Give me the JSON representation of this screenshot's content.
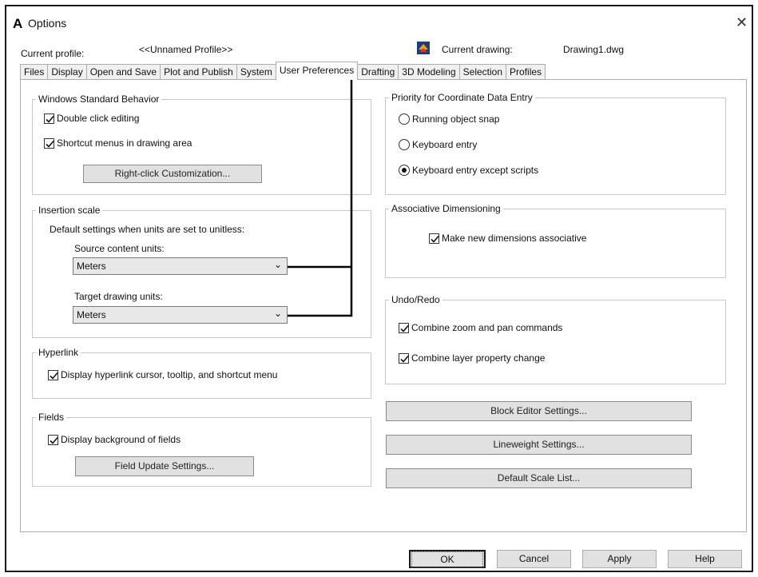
{
  "window": {
    "logo": "A",
    "title": "Options",
    "close_icon": "close-icon"
  },
  "profile_bar": {
    "current_profile_label": "Current profile:",
    "current_profile_value": "<<Unnamed Profile>>",
    "drawing_icon": "drawing-file-icon",
    "current_drawing_label": "Current drawing:",
    "current_drawing_value": "Drawing1.dwg"
  },
  "tabs": [
    {
      "label": "Files",
      "active": false
    },
    {
      "label": "Display",
      "active": false
    },
    {
      "label": "Open and Save",
      "active": false
    },
    {
      "label": "Plot and Publish",
      "active": false
    },
    {
      "label": "System",
      "active": false
    },
    {
      "label": "User Preferences",
      "active": true
    },
    {
      "label": "Drafting",
      "active": false
    },
    {
      "label": "3D Modeling",
      "active": false
    },
    {
      "label": "Selection",
      "active": false
    },
    {
      "label": "Profiles",
      "active": false
    }
  ],
  "windows_standard": {
    "title": "Windows Standard Behavior",
    "double_click": {
      "label": "Double click editing",
      "checked": true
    },
    "shortcut_menus": {
      "label": "Shortcut menus in drawing area",
      "checked": true
    },
    "right_click_button": "Right-click Customization..."
  },
  "insertion_scale": {
    "title": "Insertion scale",
    "description": "Default settings when units are set to unitless:",
    "source_label": "Source content units:",
    "source_value": "Meters",
    "target_label": "Target drawing units:",
    "target_value": "Meters"
  },
  "hyperlink": {
    "title": "Hyperlink",
    "display": {
      "label": "Display hyperlink cursor, tooltip, and shortcut menu",
      "checked": true
    }
  },
  "fields": {
    "title": "Fields",
    "display_bg": {
      "label": "Display background of fields",
      "checked": true
    },
    "update_button": "Field Update Settings..."
  },
  "priority": {
    "title": "Priority for Coordinate Data Entry",
    "options": [
      {
        "label": "Running object snap",
        "selected": false
      },
      {
        "label": "Keyboard entry",
        "selected": false
      },
      {
        "label": "Keyboard entry except scripts",
        "selected": true
      }
    ]
  },
  "assoc_dim": {
    "title": "Associative Dimensioning",
    "make_assoc": {
      "label": "Make new dimensions associative",
      "checked": true
    }
  },
  "undo_redo": {
    "title": "Undo/Redo",
    "combine_zoom": {
      "label": "Combine zoom and pan commands",
      "checked": true
    },
    "combine_layer": {
      "label": "Combine layer property change",
      "checked": true
    }
  },
  "right_buttons": {
    "block_editor": "Block Editor Settings...",
    "lineweight": "Lineweight Settings...",
    "default_scale": "Default Scale List..."
  },
  "dialog_buttons": {
    "ok": "OK",
    "cancel": "Cancel",
    "apply": "Apply",
    "help": "Help"
  },
  "colors": {
    "button_face": "#e1e1e1",
    "ok_border": "#1a1a1a",
    "group_border": "#c8c8c8",
    "annotation_line": "#000000"
  }
}
